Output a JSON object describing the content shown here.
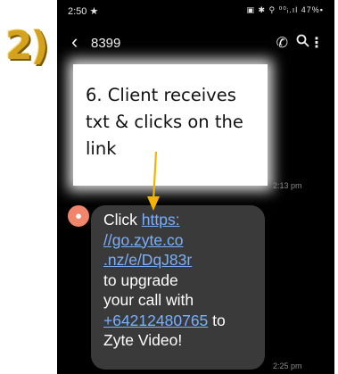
{
  "step_label": "2)",
  "status_bar": {
    "time": "2:50",
    "time_icon": "star-icon",
    "right": "▣ ✱ ⚲ ⁰⁰ᵢ.ıl 47%▪"
  },
  "conversation": {
    "contact": "8399",
    "back_icon": "back-arrow-icon",
    "actions": [
      "phone-icon",
      "search-icon",
      "more-icon"
    ]
  },
  "callout": {
    "text_lines": [
      "6. Client receives",
      "txt & clicks on the",
      "link"
    ]
  },
  "message": {
    "timestamp_prev": "2:13 pm",
    "timestamp": "2:25 pm",
    "text_before_link": "Click ",
    "link_lines": [
      "https:",
      "//go.zyte.co",
      ".nz/e/DqJ83r"
    ],
    "text_mid_lines": [
      "to upgrade",
      "your call with"
    ],
    "phone_link": "+64212480765",
    "text_after_phone": " to",
    "text_end": "Zyte Video!"
  },
  "colors": {
    "step": "#d4a21c",
    "bubble": "#3a3a3a",
    "link": "#79b0ff",
    "avatar": "#f0856b",
    "arrow": "#f3b400"
  }
}
